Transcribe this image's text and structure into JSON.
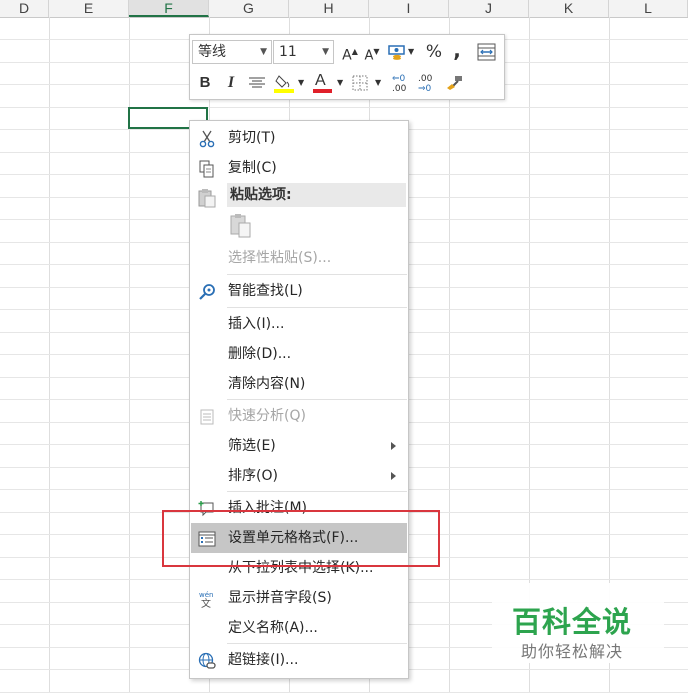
{
  "sheet": {
    "columns": [
      "D",
      "E",
      "F",
      "G",
      "H",
      "I",
      "J",
      "K",
      "L"
    ],
    "selected_column": "F"
  },
  "mini_toolbar": {
    "font_name": "等线",
    "font_size": "11",
    "grow_font": "A",
    "shrink_font": "A",
    "percent": "%",
    "comma": ",",
    "bold": "B",
    "italic": "I",
    "font_color_letter": "A",
    "font_color": "#e0202a",
    "fill_color": "#ffff00",
    "increase_decimal": ".00",
    "decrease_decimal": ".00"
  },
  "context_menu": {
    "items": [
      {
        "label": "剪切(T)",
        "icon": "scissors-icon",
        "disabled": false
      },
      {
        "label": "复制(C)",
        "icon": "copy-icon",
        "disabled": false
      },
      {
        "label": "粘贴选项:",
        "icon": "paste-icon",
        "header": true
      },
      {
        "label": "选择性粘贴(S)...",
        "disabled": true
      },
      {
        "label": "智能查找(L)",
        "icon": "smart-lookup-icon",
        "disabled": false
      },
      {
        "label": "插入(I)...",
        "disabled": false
      },
      {
        "label": "删除(D)...",
        "disabled": false
      },
      {
        "label": "清除内容(N)",
        "disabled": false
      },
      {
        "label": "快速分析(Q)",
        "icon": "quick-analysis-icon",
        "disabled": true
      },
      {
        "label": "筛选(E)",
        "submenu": true
      },
      {
        "label": "排序(O)",
        "submenu": true
      },
      {
        "label": "插入批注(M)",
        "icon": "comment-icon"
      },
      {
        "label": "设置单元格格式(F)...",
        "icon": "format-cells-icon",
        "highlighted": true
      },
      {
        "label": "从下拉列表中选择(K)..."
      },
      {
        "label": "显示拼音字段(S)",
        "icon": "phonetic-icon"
      },
      {
        "label": "定义名称(A)..."
      },
      {
        "label": "超链接(I)...",
        "icon": "hyperlink-icon"
      }
    ]
  },
  "watermark": {
    "title": "百科全说",
    "subtitle": "助你轻松解决"
  }
}
